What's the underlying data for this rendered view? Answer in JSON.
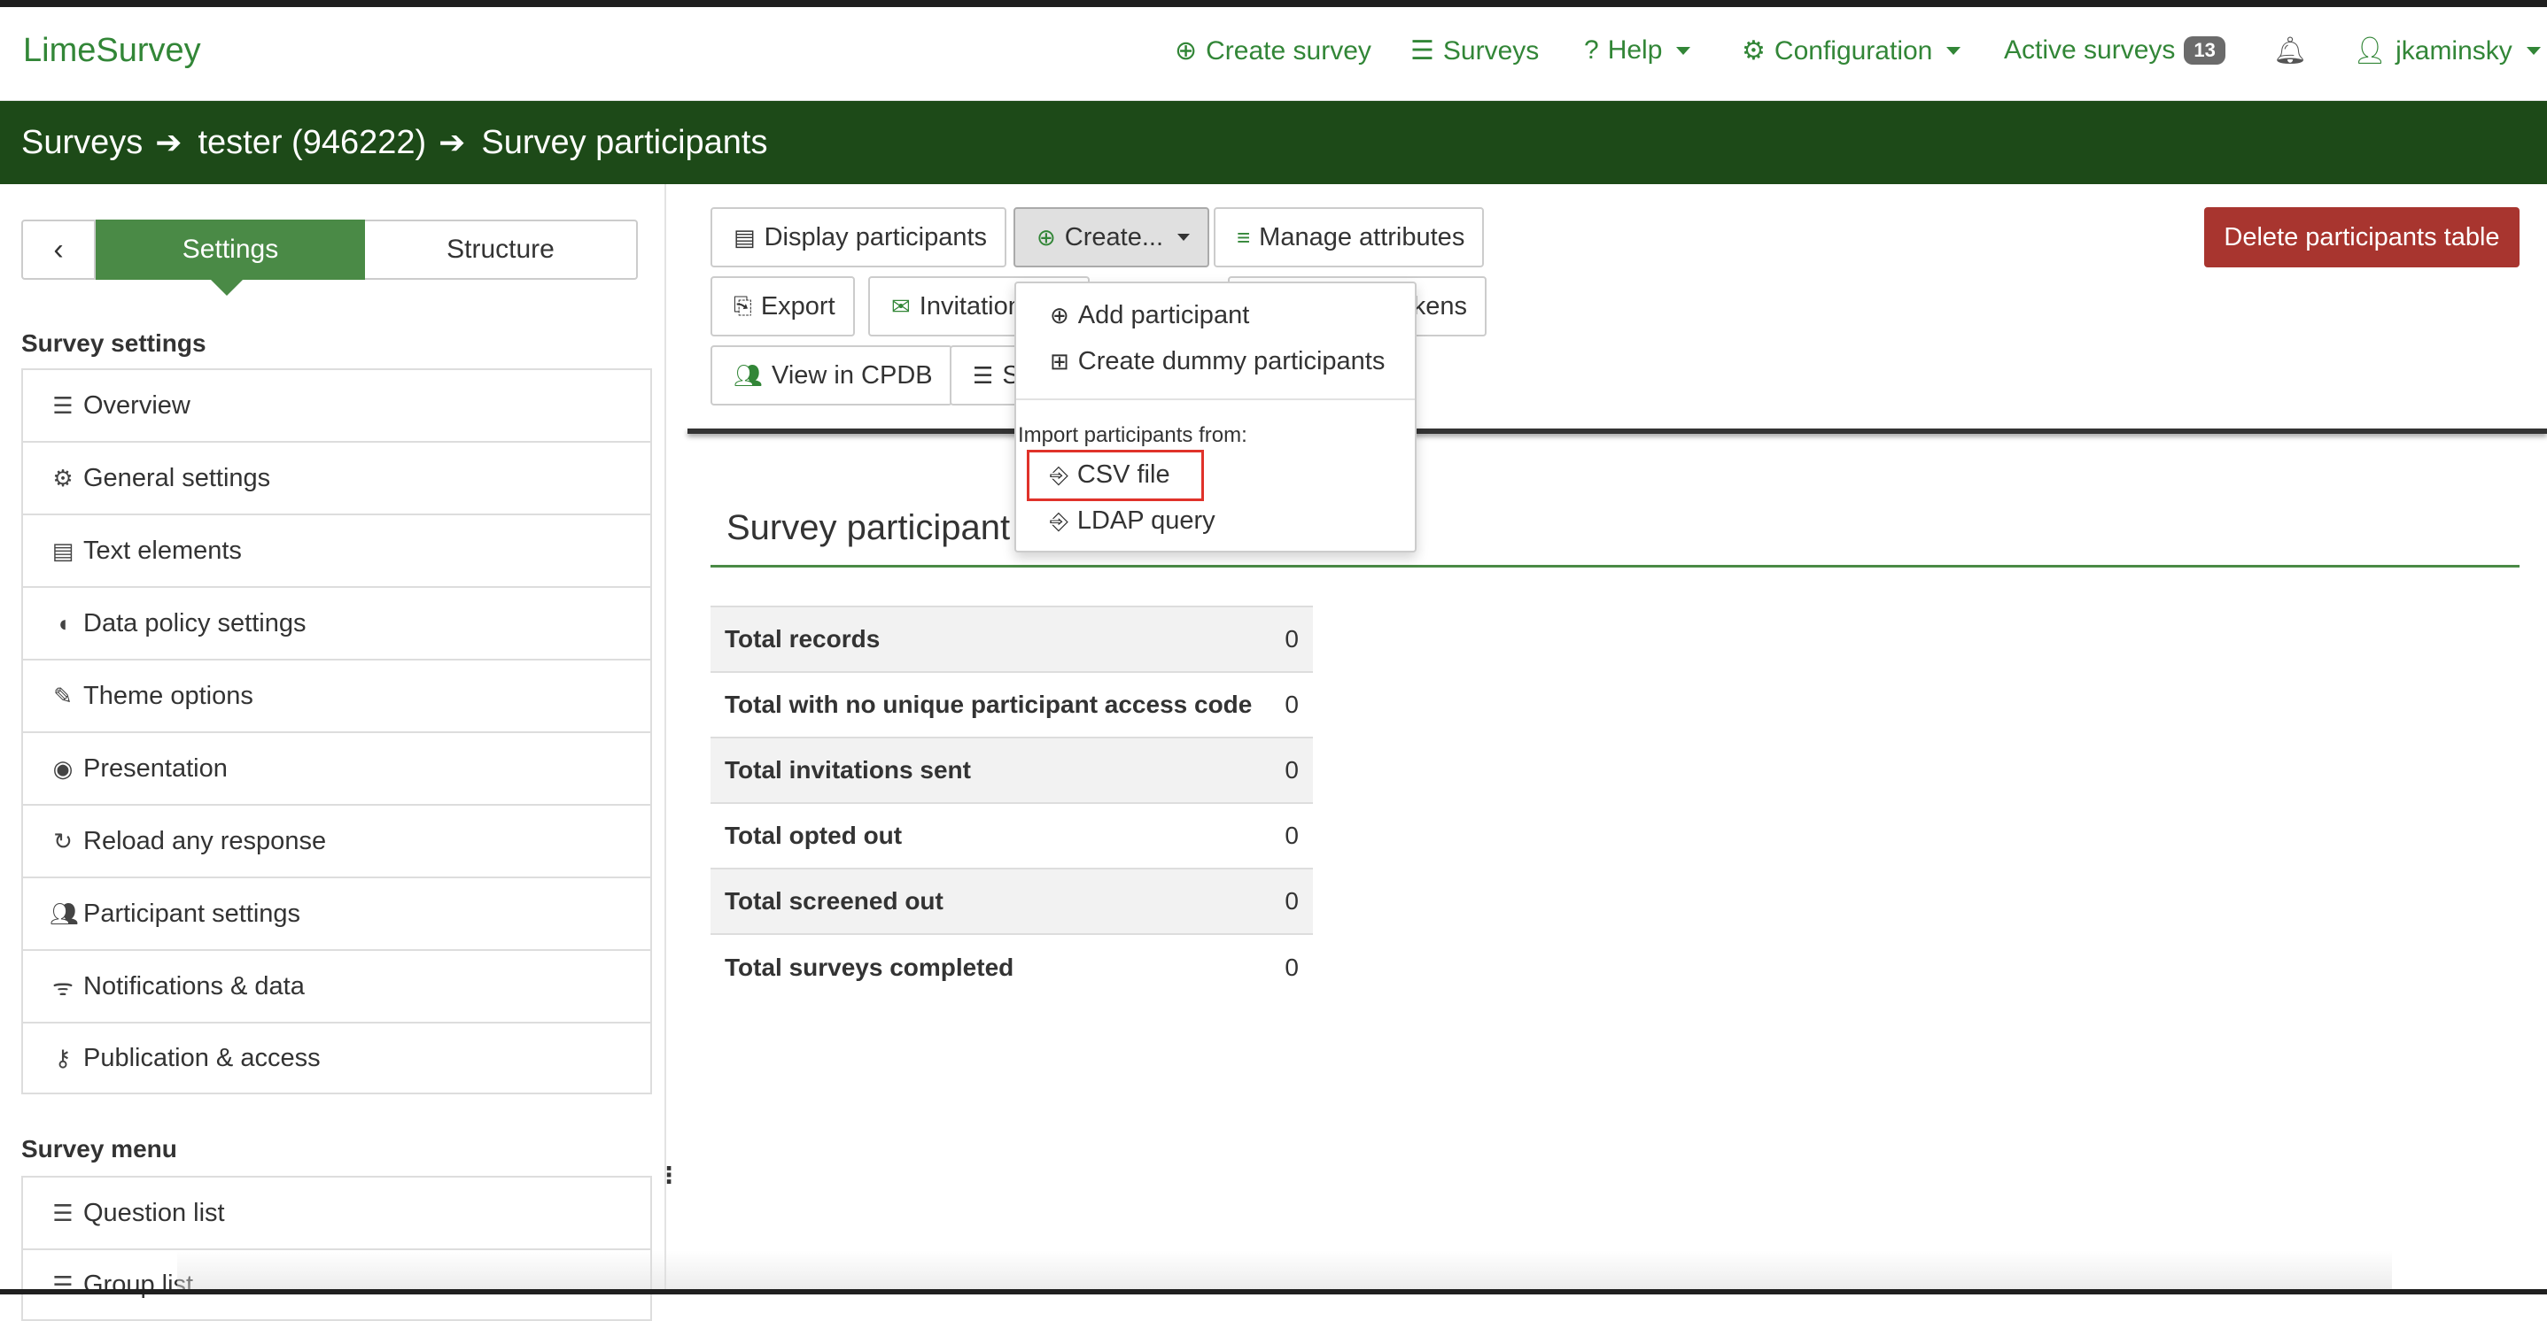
{
  "navbar": {
    "brand": "LimeSurvey",
    "create_survey": "Create survey",
    "surveys": "Surveys",
    "help": "Help",
    "configuration": "Configuration",
    "active_surveys": "Active surveys",
    "active_count": "13",
    "user": "jkaminsky"
  },
  "breadcrumb": {
    "root": "Surveys",
    "survey": "tester (946222)",
    "page": "Survey participants"
  },
  "sidebar": {
    "back_glyph": "‹",
    "tab_settings": "Settings",
    "tab_structure": "Structure",
    "survey_settings_title": "Survey settings",
    "settings_items": [
      {
        "label": "Overview"
      },
      {
        "label": "General settings"
      },
      {
        "label": "Text elements"
      },
      {
        "label": "Data policy settings"
      },
      {
        "label": "Theme options"
      },
      {
        "label": "Presentation"
      },
      {
        "label": "Reload any response"
      },
      {
        "label": "Participant settings"
      },
      {
        "label": "Notifications & data"
      },
      {
        "label": "Publication & access"
      }
    ],
    "survey_menu_title": "Survey menu",
    "menu_items": [
      {
        "label": "Question list"
      },
      {
        "label": "Group list"
      }
    ]
  },
  "toolbar": {
    "display_participants": "Display participants",
    "create": "Create...",
    "manage_attributes": "Manage attributes",
    "delete_table": "Delete participants table",
    "export": "Export",
    "invitations": "Invitation",
    "tokens_suffix": "kens",
    "view_cpdb": "View in CPDB",
    "s_partial": "S"
  },
  "dropdown": {
    "add_participant": "Add participant",
    "create_dummy": "Create dummy participants",
    "import_header": "Import participants from:",
    "csv_file": "CSV file",
    "ldap_query": "LDAP query"
  },
  "summary": {
    "title": "Survey participant",
    "rows": [
      {
        "label": "Total records",
        "value": "0"
      },
      {
        "label": "Total with no unique participant access code",
        "value": "0"
      },
      {
        "label": "Total invitations sent",
        "value": "0"
      },
      {
        "label": "Total opted out",
        "value": "0"
      },
      {
        "label": "Total screened out",
        "value": "0"
      },
      {
        "label": "Total surveys completed",
        "value": "0"
      }
    ]
  },
  "colors": {
    "brand_green": "#328637",
    "header_green": "#1d4a18",
    "tab_green": "#4a8a46",
    "danger": "#a8352f",
    "highlight": "#e0322a"
  }
}
